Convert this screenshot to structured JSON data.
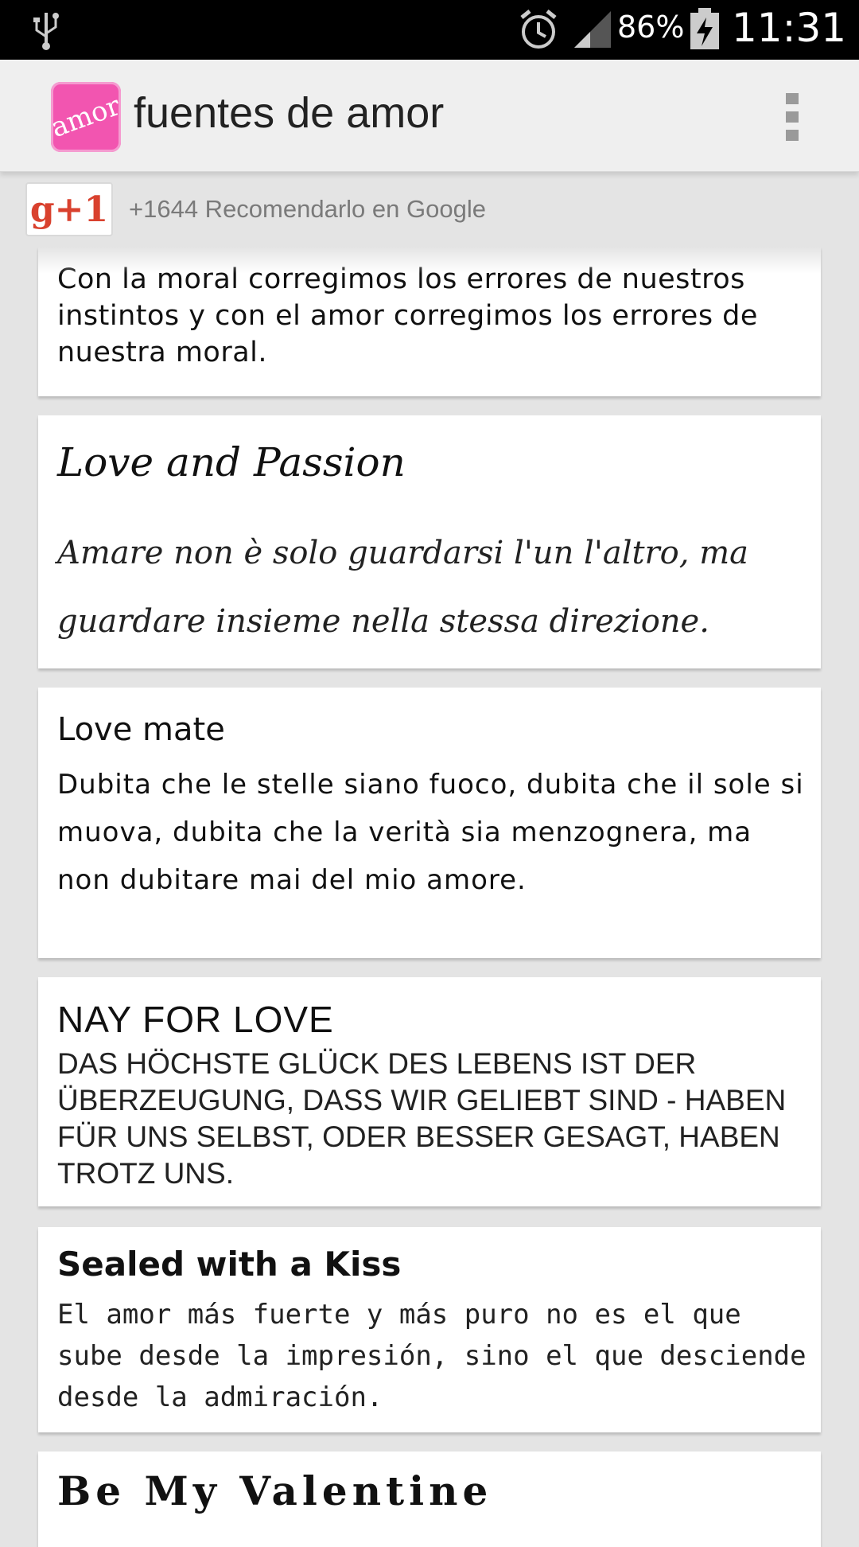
{
  "status_bar": {
    "battery_pct": "86%",
    "time": "11:31",
    "icons": [
      "usb-icon",
      "alarm-icon",
      "signal-icon",
      "battery-charging-icon"
    ]
  },
  "action_bar": {
    "app_icon_text": "amor",
    "title": "fuentes de amor",
    "overflow_icon": "overflow-menu-icon"
  },
  "gplus": {
    "button_label": "g+1",
    "text": "+1644 Recomendarlo en Google"
  },
  "cards": [
    {
      "title": "",
      "body": "Con la moral corregimos los errores de nuestros instintos y con el amor corregimos los errores de nuestra moral."
    },
    {
      "title": "Love and Passion",
      "body": "Amare non è solo guardarsi l'un l'altro, ma guardare insieme nella stessa direzione."
    },
    {
      "title": "Love mate",
      "body": "Dubita che le stelle siano fuoco, dubita che il sole si muova, dubita che la verità sia menzognera, ma non dubitare mai del mio amore."
    },
    {
      "title": "NAY FOR LOVE",
      "body": "DAS HÖCHSTE GLÜCK DES LEBENS IST DER ÜBERZEUGUNG, DASS WIR GELIEBT SIND - HABEN FÜR UNS SELBST, ODER BESSER GESAGT, HABEN TROTZ UNS."
    },
    {
      "title": "Sealed with a Kiss",
      "body": "El amor más fuerte y más puro no es el que sube desde la impresión, sino el que desciende desde la admiración."
    },
    {
      "title": "Be My Valentine",
      "body": ""
    }
  ],
  "colors": {
    "status_bar": "#000000",
    "action_bar": "#efefef",
    "background": "#e4e4e4",
    "app_icon": "#f255b0",
    "gplus_red": "#d9412e"
  }
}
